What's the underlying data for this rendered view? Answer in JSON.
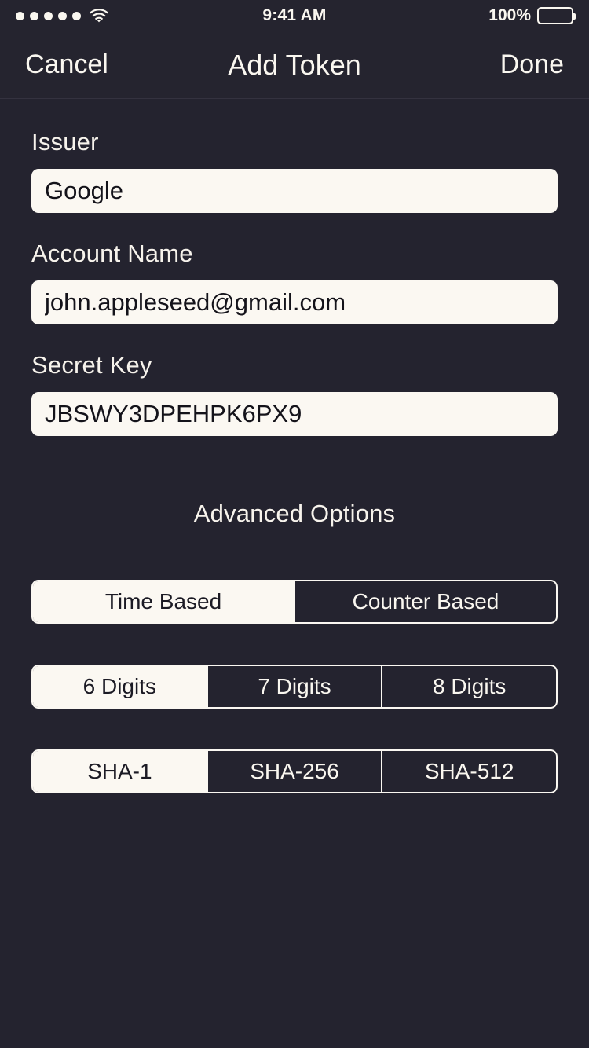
{
  "status_bar": {
    "signal_dots": 5,
    "wifi_icon": "wifi-icon",
    "time": "9:41 AM",
    "battery_percent": "100%",
    "battery_icon": "battery-full-icon"
  },
  "nav_bar": {
    "cancel_label": "Cancel",
    "title": "Add Token",
    "done_label": "Done"
  },
  "form": {
    "fields": [
      {
        "label": "Issuer",
        "value": "Google",
        "placeholder": "Issuer"
      },
      {
        "label": "Account Name",
        "value": "john.appleseed@gmail.com",
        "placeholder": "Account Name"
      },
      {
        "label": "Secret Key",
        "value": "JBSWY3DPEHPK6PX9",
        "placeholder": "Secret Key"
      }
    ]
  },
  "advanced": {
    "title": "Advanced Options",
    "controls": [
      {
        "name": "token-type",
        "options": [
          {
            "label": "Time Based",
            "selected": true
          },
          {
            "label": "Counter Based",
            "selected": false
          }
        ]
      },
      {
        "name": "digit-count",
        "options": [
          {
            "label": "6 Digits",
            "selected": true
          },
          {
            "label": "7 Digits",
            "selected": false
          },
          {
            "label": "8 Digits",
            "selected": false
          }
        ]
      },
      {
        "name": "hash-algorithm",
        "options": [
          {
            "label": "SHA-1",
            "selected": true
          },
          {
            "label": "SHA-256",
            "selected": false
          },
          {
            "label": "SHA-512",
            "selected": false
          }
        ]
      }
    ]
  },
  "colors": {
    "background": "#24232f",
    "surface": "#25242f",
    "accent_cream": "#fbf8f2",
    "text_primary": "#faf7f0",
    "text_on_cream": "#14131a"
  }
}
